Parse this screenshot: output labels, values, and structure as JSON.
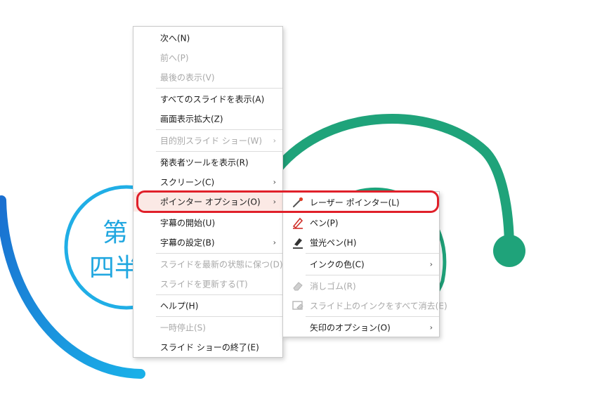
{
  "slide": {
    "text_line1": "第",
    "text_line2": "四半"
  },
  "main_menu": {
    "items": [
      {
        "label": "次へ(N)",
        "enabled": true
      },
      {
        "label": "前へ(P)",
        "enabled": false
      },
      {
        "label": "最後の表示(V)",
        "enabled": false
      },
      {
        "label": "すべてのスライドを表示(A)",
        "enabled": true
      },
      {
        "label": "画面表示拡大(Z)",
        "enabled": true
      },
      {
        "label": "目的別スライド ショー(W)",
        "enabled": false,
        "submenu": true
      },
      {
        "label": "発表者ツールを表示(R)",
        "enabled": true
      },
      {
        "label": "スクリーン(C)",
        "enabled": true,
        "submenu": true
      },
      {
        "label": "ポインター オプション(O)",
        "enabled": true,
        "submenu": true,
        "highlighted": true
      },
      {
        "label": "字幕の開始(U)",
        "enabled": true
      },
      {
        "label": "字幕の設定(B)",
        "enabled": true,
        "submenu": true
      },
      {
        "label": "スライドを最新の状態に保つ(D)",
        "enabled": false
      },
      {
        "label": "スライドを更新する(T)",
        "enabled": false
      },
      {
        "label": "ヘルプ(H)",
        "enabled": true
      },
      {
        "label": "一時停止(S)",
        "enabled": false
      },
      {
        "label": "スライド ショーの終了(E)",
        "enabled": true
      }
    ],
    "arrow_glyph": "›"
  },
  "pointer_submenu": {
    "items": [
      {
        "label": "レーザー ポインター(L)",
        "enabled": true,
        "icon": "laser-pointer-icon",
        "highlighted": true
      },
      {
        "label": "ペン(P)",
        "enabled": true,
        "icon": "pen-icon"
      },
      {
        "label": "蛍光ペン(H)",
        "enabled": true,
        "icon": "highlighter-icon"
      },
      {
        "label": "インクの色(C)",
        "enabled": true,
        "submenu": true
      },
      {
        "label": "消しゴム(R)",
        "enabled": false,
        "icon": "eraser-icon"
      },
      {
        "label": "スライド上のインクをすべて消去(E)",
        "enabled": false,
        "icon": "erase-all-ink-icon"
      },
      {
        "label": "矢印のオプション(O)",
        "enabled": true,
        "submenu": true
      }
    ]
  },
  "colors": {
    "arc_green": "#1fa37a",
    "arc_blue": "#1e7fd6",
    "ring_cyan": "#20aee6",
    "callout_red": "#e0202a",
    "highlight": "#fbe9e5"
  }
}
